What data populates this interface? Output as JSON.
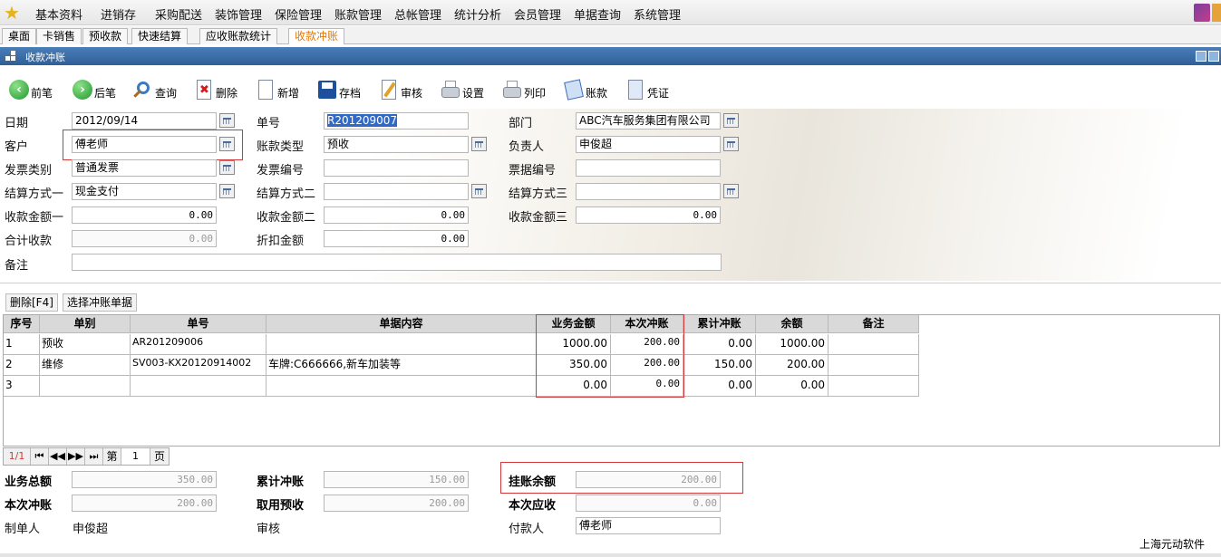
{
  "menu": {
    "items": [
      "基本资料",
      "进销存",
      "采购配送",
      "装饰管理",
      "保险管理",
      "账款管理",
      "总帐管理",
      "统计分析",
      "会员管理",
      "单据查询",
      "系统管理"
    ]
  },
  "tabs": [
    "桌面",
    "卡销售",
    "预收款",
    "快速结算",
    "应收账款统计",
    "收款冲账"
  ],
  "window": {
    "title": "收款冲账"
  },
  "toolbar": {
    "prev": "前笔",
    "next": "后笔",
    "query": "查询",
    "delete": "删除",
    "new": "新增",
    "save": "存档",
    "audit": "审核",
    "settings": "设置",
    "print": "列印",
    "account": "账款",
    "voucher": "凭证"
  },
  "form": {
    "date_label": "日期",
    "date_value": "2012/09/14",
    "doc_no_label": "单号",
    "doc_no_value": "R201209007",
    "dept_label": "部门",
    "dept_value": "ABC汽车服务集团有限公司",
    "customer_label": "客户",
    "customer_value": "傅老师",
    "acct_type_label": "账款类型",
    "acct_type_value": "预收",
    "manager_label": "负责人",
    "manager_value": "申俊超",
    "invoice_type_label": "发票类别",
    "invoice_type_value": "普通发票",
    "invoice_no_label": "发票编号",
    "invoice_no_value": "",
    "bill_no_label": "票据编号",
    "bill_no_value": "",
    "settle1_label": "结算方式一",
    "settle1_value": "现金支付",
    "settle2_label": "结算方式二",
    "settle2_value": "",
    "settle3_label": "结算方式三",
    "settle3_value": "",
    "amount1_label": "收款金额一",
    "amount1_value": "0.00",
    "amount2_label": "收款金额二",
    "amount2_value": "0.00",
    "amount3_label": "收款金额三",
    "amount3_value": "0.00",
    "total_label": "合计收款",
    "total_value": "0.00",
    "discount_label": "折扣金额",
    "discount_value": "0.00",
    "note_label": "备注",
    "note_value": ""
  },
  "grid_actions": {
    "delete": "删除[F4]",
    "select": "选择冲账单据"
  },
  "grid": {
    "headers": [
      "序号",
      "单别",
      "单号",
      "单据内容",
      "业务金额",
      "本次冲账",
      "累计冲账",
      "余额",
      "备注"
    ],
    "rows": [
      [
        "1",
        "预收",
        "AR201209006",
        "",
        "1000.00",
        "200.00",
        "0.00",
        "1000.00",
        ""
      ],
      [
        "2",
        "维修",
        "SV003-KX20120914002",
        "车牌:C666666,新车加装等",
        "350.00",
        "200.00",
        "150.00",
        "200.00",
        ""
      ],
      [
        "3",
        "",
        "",
        "",
        "0.00",
        "0.00",
        "0.00",
        "0.00",
        ""
      ]
    ]
  },
  "pager": {
    "indicator": "1/1",
    "first": "⏮",
    "prev": "◀◀",
    "next": "▶▶",
    "last": "⏭",
    "page_prefix": "第",
    "page_value": "1",
    "page_suffix": "页"
  },
  "summary": {
    "biz_total_label": "业务总额",
    "biz_total_value": "350.00",
    "cum_label": "累计冲账",
    "cum_value": "150.00",
    "hang_label": "挂账余额",
    "hang_value": "200.00",
    "this_label": "本次冲账",
    "this_value": "200.00",
    "prepay_label": "取用预收",
    "prepay_value": "200.00",
    "due_label": "本次应收",
    "due_value": "0.00",
    "maker_label": "制单人",
    "maker_value": "申俊超",
    "auditor_label": "审核",
    "auditor_value": "",
    "payer_label": "付款人",
    "payer_value": "傅老师"
  },
  "brand": "上海元动软件",
  "colors": {
    "titlebar": "#3a6ca6",
    "highlight_box": "#d23a3a",
    "active_tab": "#e07a10",
    "selection": "#3169c6"
  }
}
